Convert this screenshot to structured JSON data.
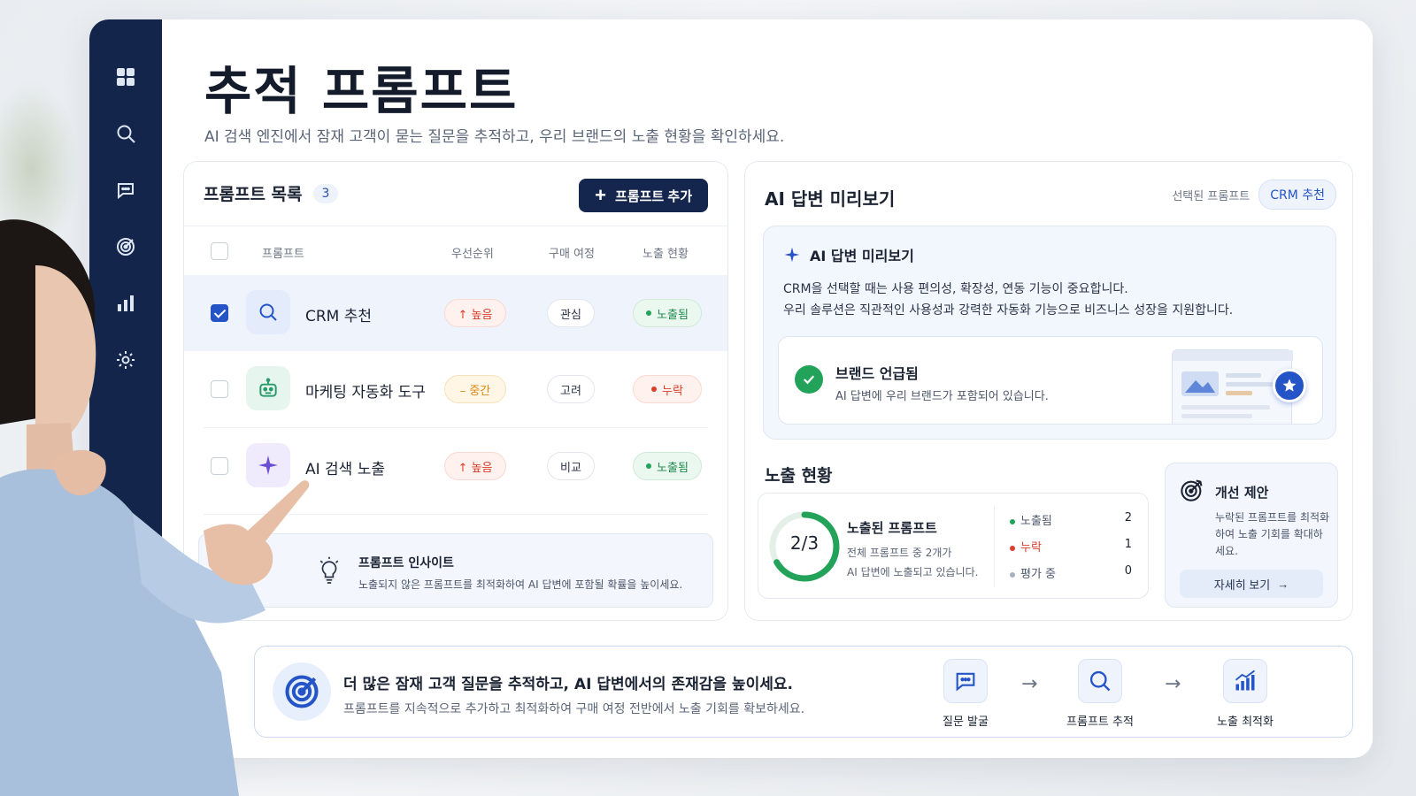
{
  "sidebar": {
    "icons": [
      "grid-icon",
      "search-icon",
      "chat-icon",
      "target-icon",
      "bar-chart-icon",
      "gear-icon"
    ]
  },
  "page": {
    "title": "추적 프롬프트",
    "subtitle": "AI 검색 엔진에서 잠재 고객이 묻는 질문을 추적하고, 우리 브랜드의 노출 현황을 확인하세요."
  },
  "prompt_list": {
    "title": "프롬프트 목록",
    "count": "3",
    "add_button": "프롬프트 추가",
    "columns": [
      "프롬프트",
      "우선순위",
      "구매 여정",
      "노출 현황"
    ],
    "rows": [
      {
        "name": "CRM 추천",
        "priority": "↑ 높음",
        "stage": "관심",
        "exposure": "노출됨",
        "checked": true,
        "icon": "search-icon"
      },
      {
        "name": "마케팅 자동화 도구",
        "priority": "– 중간",
        "stage": "고려",
        "exposure": "누락",
        "checked": false,
        "icon": "robot-icon"
      },
      {
        "name": "AI 검색 노출",
        "priority": "↑ 높음",
        "stage": "비교",
        "exposure": "노출됨",
        "checked": false,
        "icon": "sparkle-icon"
      }
    ],
    "insight": {
      "title": "프롬프트 인사이트",
      "text": "노출되지 않은 프롬프트를 최적화하여 AI 답변에 포함될 확률을 높이세요."
    }
  },
  "ai_preview": {
    "title": "AI 답변 미리보기",
    "selected_label": "선택된 프롬프트",
    "selected_value": "CRM 추천",
    "preview_title": "AI 답변 미리보기",
    "line1": "CRM을 선택할 때는 사용 편의성, 확장성, 연동 기능이 중요합니다.",
    "line2": "우리 솔루션은 직관적인 사용성과 강력한 자동화 기능으로 비즈니스 성장을 지원합니다.",
    "brand_title": "브랜드 언급됨",
    "brand_text": "AI 답변에 우리 브랜드가 포함되어 있습니다."
  },
  "exposure": {
    "title": "노출 현황",
    "ratio_label": "2/3",
    "ratio_fraction": 0.667,
    "heading": "노출된 프롬프트",
    "line1": "전체 프롬프트 중 2개가",
    "line2": "AI 답변에 노출되고 있습니다.",
    "legend": [
      {
        "label": "노출됨",
        "value": "2",
        "color": "#23a35a"
      },
      {
        "label": "누락",
        "value": "1",
        "color": "#d9402b"
      },
      {
        "label": "평가 중",
        "value": "0",
        "color": "#a8b0bf"
      }
    ]
  },
  "suggestion": {
    "title": "개선 제안",
    "text": "누락된 프롬프트를 최적화하여 노출 기회를 확대하세요.",
    "button": "자세히 보기"
  },
  "banner": {
    "title": "더 많은 잠재 고객 질문을 추적하고, AI 답변에서의 존재감을 높이세요.",
    "text": "프롬프트를 지속적으로 추가하고 최적화하여 구매 여정 전반에서 노출 기회를 확보하세요.",
    "steps": [
      "질문 발굴",
      "프롬프트 추적",
      "노출 최적화"
    ]
  },
  "colors": {
    "navy": "#13254a",
    "accent": "#2554c7",
    "green": "#23a35a",
    "red": "#d9402b",
    "orange": "#d98a12"
  }
}
